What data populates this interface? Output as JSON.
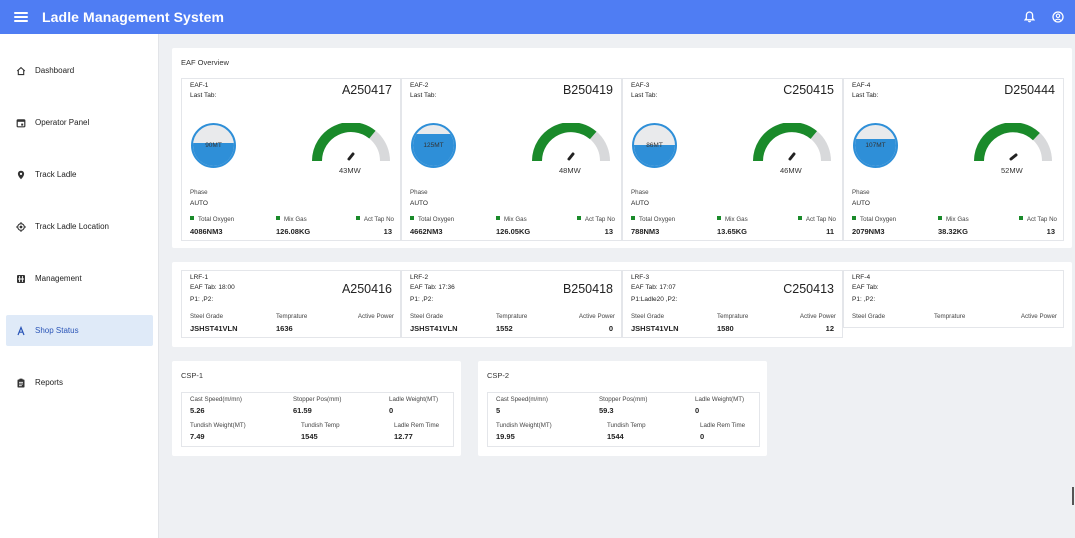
{
  "app": {
    "title": "Ladle Management System"
  },
  "sidebar": {
    "items": [
      {
        "label": "Dashboard",
        "icon": "home-icon"
      },
      {
        "label": "Operator Panel",
        "icon": "calendar-icon"
      },
      {
        "label": "Track Ladle",
        "icon": "location-pin-icon"
      },
      {
        "label": "Track Ladle Location",
        "icon": "crosshair-icon"
      },
      {
        "label": "Management",
        "icon": "grid-icon"
      },
      {
        "label": "Shop Status",
        "icon": "triangle-a-icon",
        "active": true
      },
      {
        "label": "Reports",
        "icon": "clipboard-icon"
      }
    ]
  },
  "eaf": {
    "title": "EAF Overview",
    "units": [
      {
        "name": "EAF-1",
        "last_tab": "Last Tab:",
        "id": "A250417",
        "tank": "90MT",
        "tank_fill": 0.55,
        "mw": "43MW",
        "mw_fraction": 0.7,
        "phase_label": "Phase",
        "phase": "AUTO",
        "oxy_label": "Total Oxygen",
        "gas_label": "Mix Gas",
        "tap_label": "Act Tap No",
        "oxy": "4086NM3",
        "gas": "126.08KG",
        "tap": "13"
      },
      {
        "name": "EAF-2",
        "last_tab": "Last Tab:",
        "id": "B250419",
        "tank": "125MT",
        "tank_fill": 0.78,
        "mw": "48MW",
        "mw_fraction": 0.72,
        "phase_label": "Phase",
        "phase": "AUTO",
        "oxy_label": "Total Oxygen",
        "gas_label": "Mix Gas",
        "tap_label": "Act Tap No",
        "oxy": "4662NM3",
        "gas": "126.05KG",
        "tap": "13"
      },
      {
        "name": "EAF-3",
        "last_tab": "Last Tab:",
        "id": "C250415",
        "tank": "86MT",
        "tank_fill": 0.52,
        "mw": "46MW",
        "mw_fraction": 0.71,
        "phase_label": "Phase",
        "phase": "AUTO",
        "oxy_label": "Total Oxygen",
        "gas_label": "Mix Gas",
        "tap_label": "Act Tap No",
        "oxy": "788NM3",
        "gas": "13.65KG",
        "tap": "11"
      },
      {
        "name": "EAF-4",
        "last_tab": "Last Tab:",
        "id": "D250444",
        "tank": "107MT",
        "tank_fill": 0.65,
        "mw": "52MW",
        "mw_fraction": 0.74,
        "phase_label": "Phase",
        "phase": "AUTO",
        "oxy_label": "Total Oxygen",
        "gas_label": "Mix Gas",
        "tap_label": "Act Tap No",
        "oxy": "2079NM3",
        "gas": "38.32KG",
        "tap": "13"
      }
    ]
  },
  "lrf": {
    "units": [
      {
        "name": "LRF-1",
        "eaf_tab": "EAF Tab: 18:00",
        "p": "P1: ,P2:",
        "id": "A250416",
        "grade_label": "Steel Grade",
        "temp_label": "Temprature",
        "power_label": "Active Power",
        "grade": "JSHST41VLN",
        "temp": "1636",
        "power": ""
      },
      {
        "name": "LRF-2",
        "eaf_tab": "EAF Tab: 17:36",
        "p": "P1: ,P2:",
        "id": "B250418",
        "grade_label": "Steel Grade",
        "temp_label": "Temprature",
        "power_label": "Active Power",
        "grade": "JSHST41VLN",
        "temp": "1552",
        "power": "0"
      },
      {
        "name": "LRF-3",
        "eaf_tab": "EAF Tab: 17:07",
        "p": "P1:Ladle20 ,P2:",
        "id": "C250413",
        "grade_label": "Steel Grade",
        "temp_label": "Temprature",
        "power_label": "Active Power",
        "grade": "JSHST41VLN",
        "temp": "1580",
        "power": "12"
      },
      {
        "name": "LRF-4",
        "eaf_tab": "EAF Tab:",
        "p": "P1: ,P2:",
        "id": "",
        "grade_label": "Steel Grade",
        "temp_label": "Temprature",
        "power_label": "Active Power",
        "grade": "",
        "temp": "",
        "power": ""
      }
    ]
  },
  "csp": {
    "units": [
      {
        "name": "CSP-1",
        "cast_speed_label": "Cast Speed(m/mn)",
        "stopper_label": "Stopper Pos(mm)",
        "ladle_weight_label": "Ladle Weight(MT)",
        "cast_speed": "5.26",
        "stopper": "61.59",
        "ladle_weight": "0",
        "tundish_weight_label": "Tundish Weight(MT)",
        "tundish_temp_label": "Tundish Temp",
        "ladle_rem_label": "Ladle Rem Time",
        "tundish_weight": "7.49",
        "tundish_temp": "1545",
        "ladle_rem": "12.77"
      },
      {
        "name": "CSP-2",
        "cast_speed_label": "Cast Speed(m/mn)",
        "stopper_label": "Stopper Pos(mm)",
        "ladle_weight_label": "Ladle Weight(MT)",
        "cast_speed": "5",
        "stopper": "59.3",
        "ladle_weight": "0",
        "tundish_weight_label": "Tundish Weight(MT)",
        "tundish_temp_label": "Tundish Temp",
        "ladle_rem_label": "Ladle Rem Time",
        "tundish_weight": "19.95",
        "tundish_temp": "1544",
        "ladle_rem": "0"
      }
    ]
  },
  "colors": {
    "topbar": "#4f7df3",
    "gauge": "#1a8a2a",
    "tank": "#2e8fd8",
    "active_nav": "#dfeaf8"
  }
}
